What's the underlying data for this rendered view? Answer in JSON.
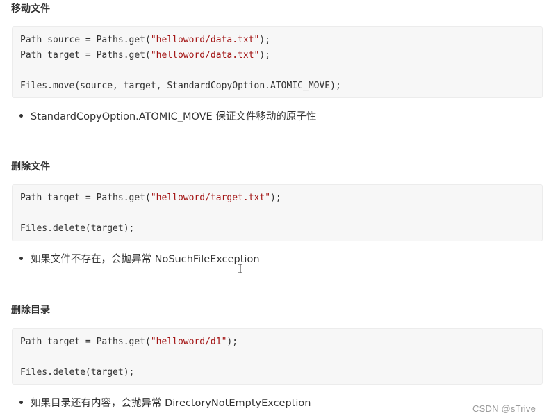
{
  "sections": [
    {
      "heading": "移动文件",
      "code": [
        {
          "pre": "Path source = Paths.get(",
          "str": "\"helloword/data.txt\"",
          "post": ");"
        },
        {
          "pre": "Path target = Paths.get(",
          "str": "\"helloword/data.txt\"",
          "post": ");"
        },
        {
          "pre": "Files.move(source, target, StandardCopyOption.ATOMIC_MOVE);",
          "str": "",
          "post": ""
        }
      ],
      "bullet": "StandardCopyOption.ATOMIC_MOVE 保证文件移动的原子性"
    },
    {
      "heading": "删除文件",
      "code": [
        {
          "pre": "Path target = Paths.get(",
          "str": "\"helloword/target.txt\"",
          "post": ");"
        },
        {
          "pre": "Files.delete(target);",
          "str": "",
          "post": ""
        }
      ],
      "bullet": "如果文件不存在，会抛异常 NoSuchFileException"
    },
    {
      "heading": "删除目录",
      "code": [
        {
          "pre": "Path target = Paths.get(",
          "str": "\"helloword/d1\"",
          "post": ");"
        },
        {
          "pre": "Files.delete(target);",
          "str": "",
          "post": ""
        }
      ],
      "bullet": "如果目录还有内容，会抛异常 DirectoryNotEmptyException"
    }
  ],
  "cursor_icon": "text-cursor-icon",
  "watermark": "CSDN @sTrive",
  "colors": {
    "code_bg": "#f7f7f7",
    "string": "#a31515",
    "text": "#333333"
  }
}
